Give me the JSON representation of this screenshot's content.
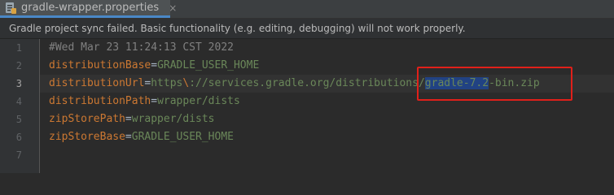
{
  "tab": {
    "title": "gradle-wrapper.properties",
    "close_glyph": "×",
    "icon": "properties-file-icon"
  },
  "banner": {
    "message": "Gradle project sync failed. Basic functionality (e.g. editing, debugging) will not work properly."
  },
  "lines": [
    {
      "number": "1",
      "comment": "#Wed Mar 23 11:24:13 CST 2022"
    },
    {
      "number": "2",
      "key": "distributionBase",
      "eq": "=",
      "value": "GRADLE_USER_HOME"
    },
    {
      "number": "3",
      "key": "distributionUrl",
      "eq": "=",
      "value_pre": "https",
      "value_esc": "\\",
      "value_mid": "://services.gradle.org/distributions/",
      "value_sel": "gradle-7.2",
      "value_post": "-bin.zip"
    },
    {
      "number": "4",
      "key": "distributionPath",
      "eq": "=",
      "value": "wrapper/dists"
    },
    {
      "number": "5",
      "key": "zipStorePath",
      "eq": "=",
      "value": "wrapper/dists"
    },
    {
      "number": "6",
      "key": "zipStoreBase",
      "eq": "=",
      "value": "GRADLE_USER_HOME"
    },
    {
      "number": "7"
    }
  ],
  "colors": {
    "background": "#2b2b2b",
    "key": "#cc7832",
    "value": "#6a8759",
    "comment": "#808080",
    "selection": "#214283",
    "highlight_box": "#e0201a"
  }
}
